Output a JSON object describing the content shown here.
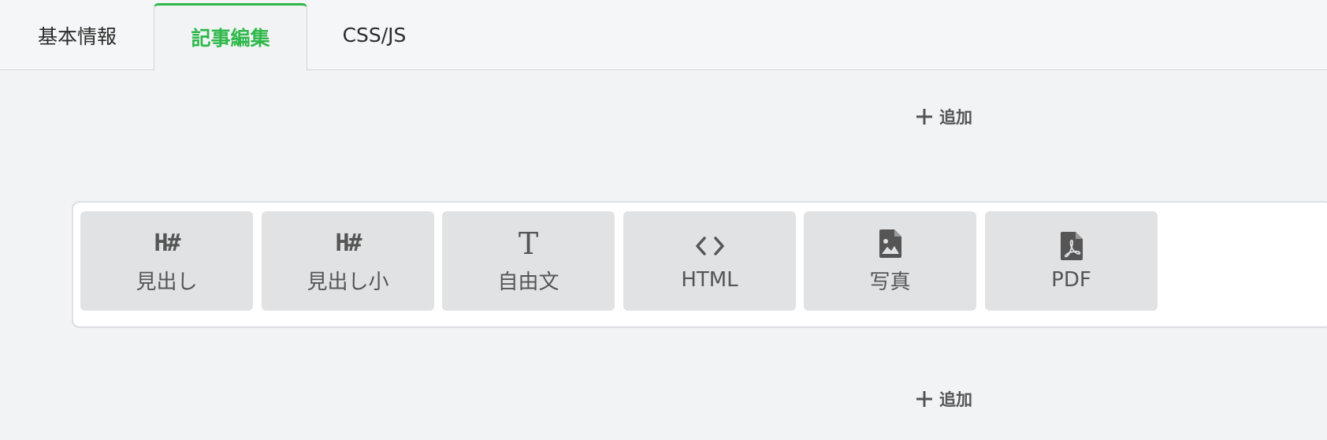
{
  "tabs": [
    {
      "label": "基本情報",
      "active": false
    },
    {
      "label": "記事編集",
      "active": true
    },
    {
      "label": "CSS/JS",
      "active": false
    }
  ],
  "add_buttons": {
    "top_label": "追加",
    "bottom_label": "追加"
  },
  "blocks": [
    {
      "symbol": "H#",
      "label": "見出し",
      "icon": "heading-icon"
    },
    {
      "symbol": "H#",
      "label": "見出し小",
      "icon": "subheading-icon"
    },
    {
      "symbol": "T",
      "label": "自由文",
      "icon": "text-icon"
    },
    {
      "symbol": "<>",
      "label": "HTML",
      "icon": "code-icon"
    },
    {
      "symbol": "",
      "label": "写真",
      "icon": "image-file-icon"
    },
    {
      "symbol": "",
      "label": "PDF",
      "icon": "pdf-file-icon"
    }
  ],
  "colors": {
    "accent": "#2eb84a",
    "background": "#f2f3f5",
    "block_bg": "#e1e2e4",
    "text_muted": "#555555"
  }
}
